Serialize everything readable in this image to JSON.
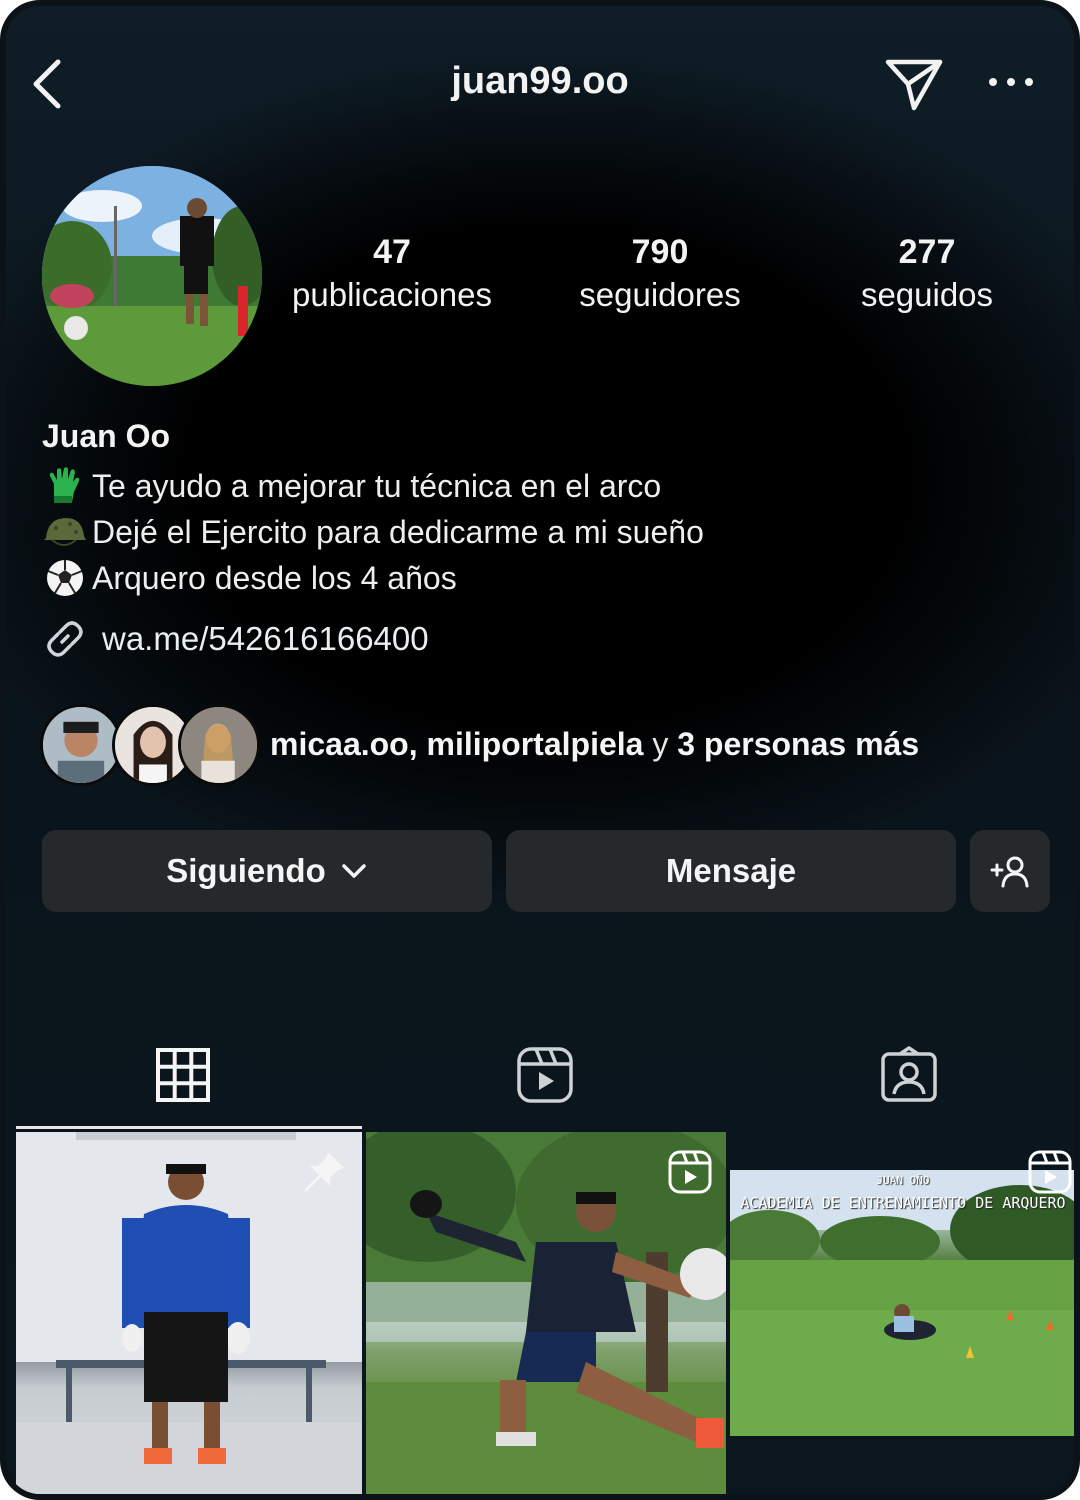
{
  "header": {
    "username": "juan99.oo"
  },
  "stats": {
    "posts_count": "47",
    "posts_label": "publicaciones",
    "followers_count": "790",
    "followers_label": "seguidores",
    "following_count": "277",
    "following_label": "seguidos"
  },
  "bio": {
    "full_name": "Juan Oo",
    "lines": [
      {
        "emoji": "goalkeeper-glove-icon",
        "text": "Te ayudo a mejorar tu técnica en el arco"
      },
      {
        "emoji": "military-helmet-icon",
        "text": "Dejé el Ejercito para dedicarme a mi sueño"
      },
      {
        "emoji": "soccer-ball-icon",
        "text": "Arquero desde los 4 años"
      }
    ],
    "link": "wa.me/542616166400"
  },
  "followed_by": {
    "names": "micaa.oo, miliportalpiela",
    "connector": "y",
    "others": "3 personas más"
  },
  "buttons": {
    "following_label": "Siguiendo",
    "message_label": "Mensaje"
  },
  "tabs": [
    {
      "icon": "grid-icon",
      "active": true
    },
    {
      "icon": "reels-icon",
      "active": false
    },
    {
      "icon": "tagged-icon",
      "active": false
    }
  ],
  "posts": [
    {
      "type": "photo",
      "pinned": true
    },
    {
      "type": "reel",
      "pinned": false
    },
    {
      "type": "reel",
      "pinned": false,
      "overlay_top": "JUAN OÑO",
      "overlay_title": "ACADEMIA DE ENTRENAMIENTO DE ARQUERO"
    }
  ],
  "colors": {
    "background": "#000000",
    "button_bg": "#26292c",
    "text": "#f5f5f5"
  }
}
